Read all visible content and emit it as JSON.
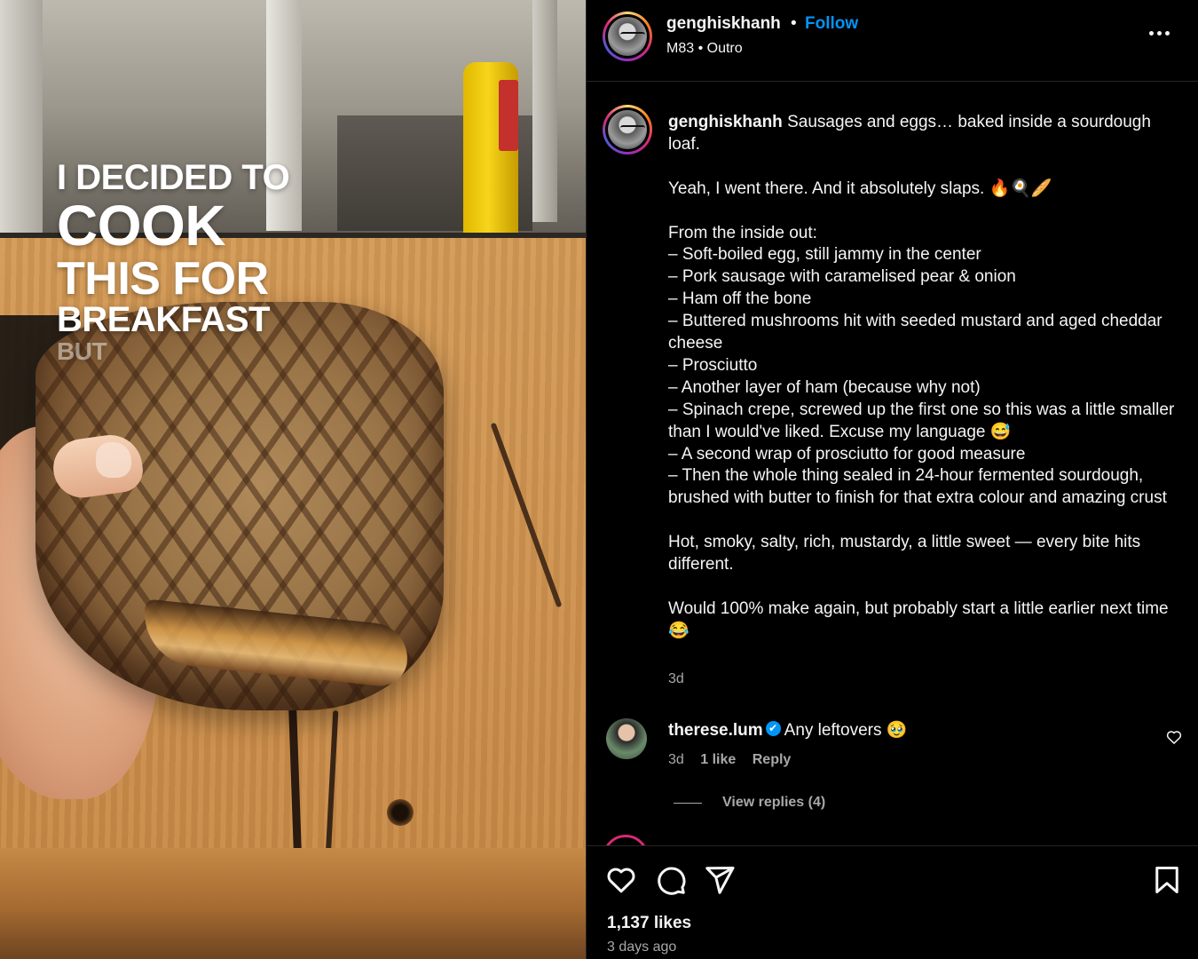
{
  "media": {
    "overlay_lines": [
      "I DECIDED TO",
      "COOK",
      "THIS FOR",
      "BREAKFAST",
      "BUT"
    ]
  },
  "header": {
    "username": "genghiskhanh",
    "separator": "•",
    "follow_label": "Follow",
    "audio": "M83 • Outro"
  },
  "caption": {
    "username": "genghiskhanh",
    "first_line": " Sausages and eggs… baked inside a sourdough loaf.",
    "p1": "Yeah, I went there. And it absolutely slaps. 🔥🍳🥖",
    "p2_lines": [
      "From the inside out:",
      "– Soft-boiled egg, still jammy in the center",
      "– Pork sausage with caramelised pear & onion",
      "– Ham off the bone",
      "– Buttered mushrooms hit with seeded mustard and aged cheddar cheese",
      "– Prosciutto",
      "– Another layer of ham (because why not)",
      "– Spinach crepe, screwed up the first one so this was a little smaller than I would've liked. Excuse my language 😅",
      "– A second wrap of prosciutto for good measure",
      "– Then the whole thing sealed in 24-hour fermented sourdough, brushed with butter to finish for that extra colour and amazing crust"
    ],
    "p3": "Hot, smoky, salty, rich, mustardy, a little sweet — every bite hits different.",
    "p4": "Would 100% make again, but probably start a little earlier next time 😂",
    "time": "3d"
  },
  "comment": {
    "username": "therese.lum",
    "verified_icon": "✔",
    "text": "Any leftovers 🥹",
    "time": "3d",
    "likes": "1 like",
    "reply_label": "Reply",
    "view_replies": "View replies (4)"
  },
  "footer": {
    "likes": "1,137 likes",
    "ago": "3 days ago",
    "icons": [
      "heart-icon",
      "comment-icon",
      "share-icon",
      "bookmark-icon"
    ]
  },
  "colors": {
    "accent": "#0095f6",
    "text": "#f5f5f5",
    "muted": "#a8a8a8",
    "background": "#000000"
  }
}
